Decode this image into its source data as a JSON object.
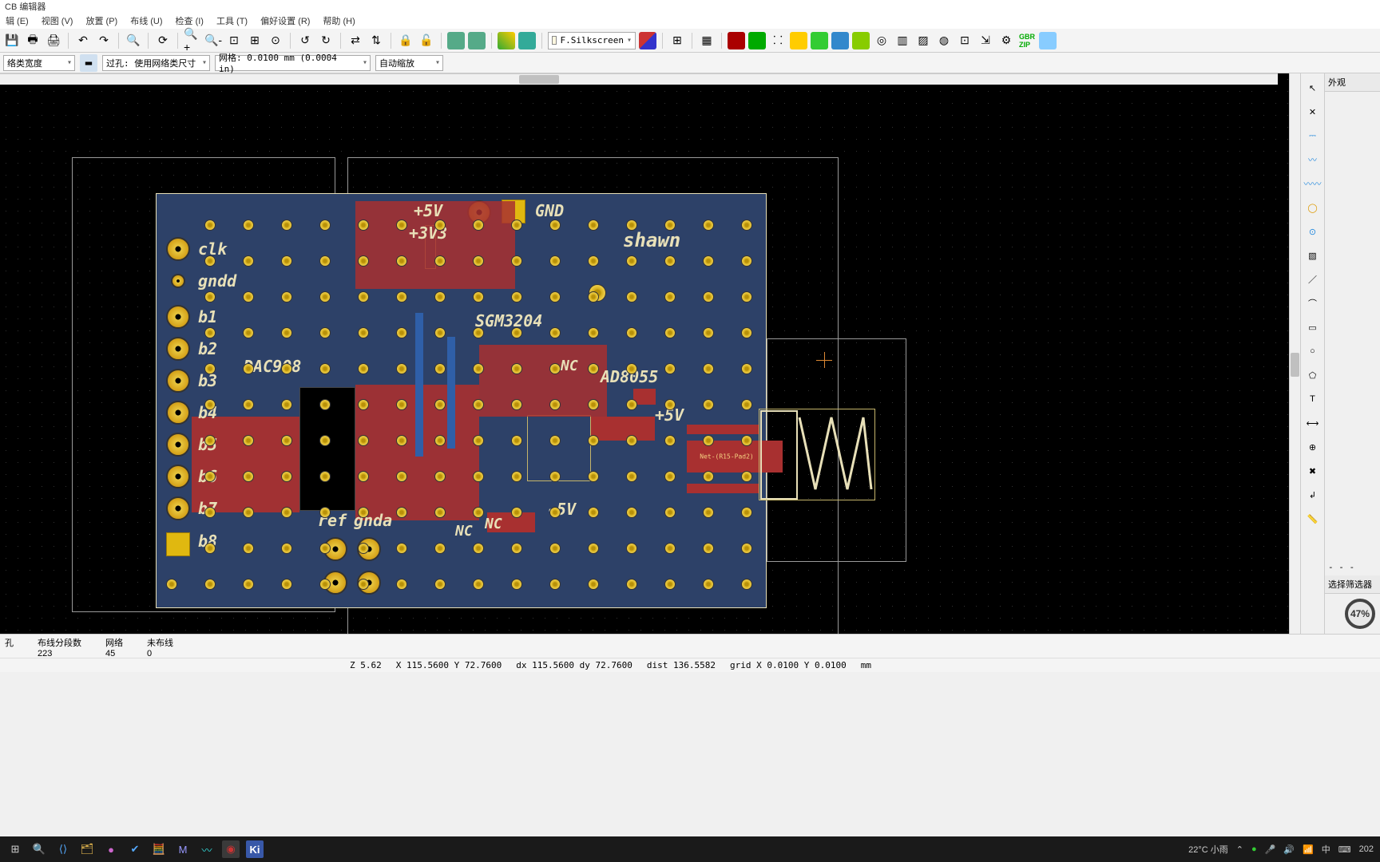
{
  "title": "CB 编辑器",
  "menu": {
    "edit": "辑 (E)",
    "view": "视图 (V)",
    "place": "放置 (P)",
    "route": "布线 (U)",
    "inspect": "检查 (I)",
    "tools": "工具 (T)",
    "prefs": "偏好设置 (R)",
    "help": "帮助 (H)"
  },
  "toolbar": {
    "layer": "F.Silkscreen"
  },
  "row2": {
    "combo1": "络类宽度",
    "via_combo": "过孔: 使用网络类尺寸",
    "grid_combo": "网格: 0.0100 mm (0.0004 in)",
    "zoom_combo": "自动缩放"
  },
  "right_panel": {
    "appearance": "外观",
    "dashes": "- - -",
    "filter": "选择筛选器",
    "progress": "47%"
  },
  "silkscreen": {
    "clk": "clk",
    "gndd": "gndd",
    "b1": "b1",
    "b2": "b2",
    "b3": "b3",
    "b4": "b4",
    "b5": "b5",
    "b6": "b6",
    "b7": "b7",
    "b8": "b8",
    "dac": "DAC908",
    "p5v": "+5V",
    "p3v3": "+3V3",
    "gnd_top": "GND",
    "shawn": "shawn",
    "sgm": "SGM3204",
    "nc1": "NC",
    "nc2": "NC",
    "nc3": "NC",
    "ad": "AD8055",
    "p5v2": "+5V",
    "m5v": "-5V",
    "ref": "ref",
    "gnda": "gnda",
    "netlabel": "Net-(R15-Pad2)"
  },
  "status": {
    "col1_t": "孔",
    "col1_v": "",
    "col2_t": "布线分段数",
    "col2_v": "223",
    "col3_t": "网络",
    "col3_v": "45",
    "col4_t": "未布线",
    "col4_v": "0"
  },
  "coord": {
    "z": "Z 5.62",
    "xy": "X 115.5600  Y 72.7600",
    "dxy": "dx 115.5600  dy 72.7600",
    "dist": "dist 136.5582",
    "grid": "grid X 0.0100  Y 0.0100",
    "unit": "mm"
  },
  "taskbar": {
    "weather": "22°C 小雨",
    "year": "202"
  }
}
